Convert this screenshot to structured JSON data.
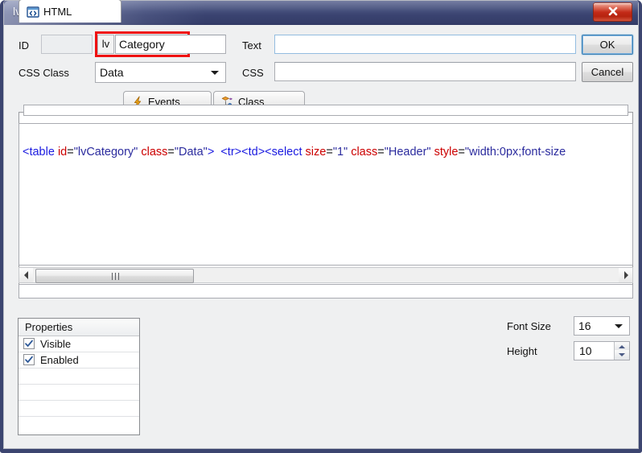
{
  "window": {
    "title": "lvCategory",
    "close_icon": "close-icon"
  },
  "form": {
    "id_label": "ID",
    "id_value": "",
    "lv_prefix": "lv",
    "name_value": "Category",
    "css_class_label": "CSS Class",
    "css_class_value": "Data",
    "text_label": "Text",
    "text_value": "",
    "css_label": "CSS",
    "css_value": "",
    "highlight_color": "#ef1010"
  },
  "buttons": {
    "ok_label": "OK",
    "cancel_label": "Cancel"
  },
  "tabs": [
    {
      "label": "HTML",
      "icon": "code-brackets-icon",
      "active": true
    },
    {
      "label": "Events",
      "icon": "lightning-bolt-icon",
      "active": false
    },
    {
      "label": "Class",
      "icon": "class-diamond-icon",
      "active": false
    }
  ],
  "editor": {
    "top_field_value": "",
    "code_tokens": [
      {
        "t": "tag",
        "s": "<table "
      },
      {
        "t": "attr",
        "s": "id"
      },
      {
        "t": "plain",
        "s": "="
      },
      {
        "t": "val",
        "s": "\"lvCategory\" "
      },
      {
        "t": "attr",
        "s": "class"
      },
      {
        "t": "plain",
        "s": "="
      },
      {
        "t": "val",
        "s": "\"Data\""
      },
      {
        "t": "tag",
        "s": ">"
      },
      {
        "t": "plain",
        "s": "  "
      },
      {
        "t": "tag",
        "s": "<tr><td><select "
      },
      {
        "t": "attr",
        "s": "size"
      },
      {
        "t": "plain",
        "s": "="
      },
      {
        "t": "val",
        "s": "\"1\" "
      },
      {
        "t": "attr",
        "s": "class"
      },
      {
        "t": "plain",
        "s": "="
      },
      {
        "t": "val",
        "s": "\"Header\" "
      },
      {
        "t": "attr",
        "s": "style"
      },
      {
        "t": "plain",
        "s": "="
      },
      {
        "t": "val",
        "s": "\"width:0px;font-size"
      }
    ]
  },
  "properties": {
    "header": "Properties",
    "rows": [
      {
        "label": "Visible",
        "checked": true
      },
      {
        "label": "Enabled",
        "checked": true
      },
      {
        "label": "",
        "checked": null
      },
      {
        "label": "",
        "checked": null
      },
      {
        "label": "",
        "checked": null
      },
      {
        "label": "",
        "checked": null
      }
    ]
  },
  "controls": {
    "font_size_label": "Font Size",
    "font_size_value": "16",
    "height_label": "Height",
    "height_value": "10"
  }
}
